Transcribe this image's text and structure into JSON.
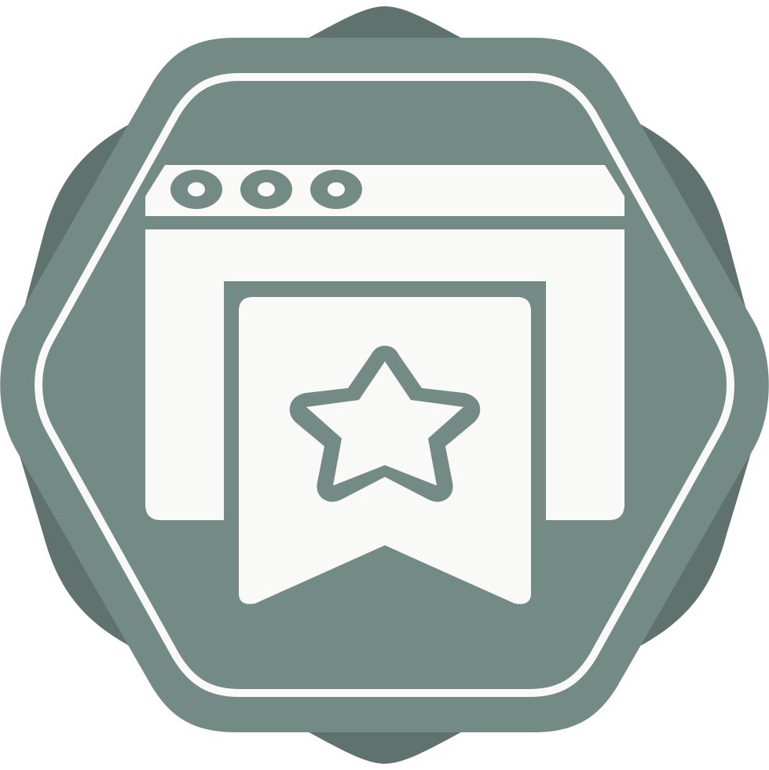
{
  "icon": {
    "name": "browser-bookmark-star-badge",
    "depicts": [
      "badge-background",
      "hexagon-frame",
      "browser-window",
      "bookmark-ribbon",
      "star"
    ],
    "window_dot_count": 3
  },
  "colors": {
    "background": "#ffffff",
    "badge_dark": "#5f726d",
    "badge_main": "#748a85",
    "foreground": "#f9faf8"
  }
}
